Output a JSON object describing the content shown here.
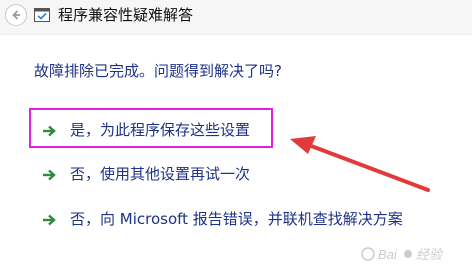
{
  "window": {
    "title": "程序兼容性疑难解答"
  },
  "main": {
    "question": "故障排除已完成。问题得到解决了吗?",
    "options": [
      {
        "label": "是，为此程序保存这些设置"
      },
      {
        "label": "否，使用其他设置再试一次"
      },
      {
        "label": "否，向 Microsoft 报告错误，并联机查找解决方案"
      }
    ]
  },
  "colors": {
    "text_blue": "#1e3287",
    "arrow_green": "#2e8b3d",
    "highlight_magenta": "#e11ee1",
    "annotation_red": "#e03a3a"
  }
}
